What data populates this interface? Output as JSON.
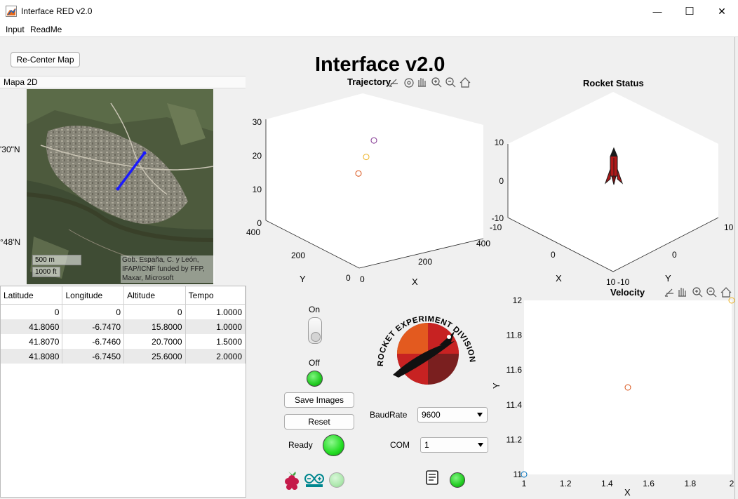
{
  "window": {
    "title": "Interface RED v2.0",
    "controls": {
      "minimize": "—",
      "maximize": "☐",
      "close": "✕"
    }
  },
  "menu": {
    "items": [
      "Input",
      "ReadMe"
    ]
  },
  "map_panel": {
    "recenter_label": "Re-Center Map",
    "tab_label": "Mapa 2D",
    "lat_tick_1": "'30\"N",
    "lat_tick_2": "°48'N",
    "scale_m": "500 m",
    "scale_ft": "1000 ft",
    "attribution_1": "Gob. España, C. y León,",
    "attribution_2": "IFAP/ICNF funded by FFP,",
    "attribution_3": "Maxar, Microsoft",
    "route_color": "#1a1aff"
  },
  "table": {
    "headers": [
      "Latitude",
      "Longitude",
      "Altitude",
      "Tempo"
    ],
    "rows": [
      [
        "0",
        "0",
        "0",
        "1.0000"
      ],
      [
        "41.8060",
        "-6.7470",
        "15.8000",
        "1.0000"
      ],
      [
        "41.8070",
        "-6.7460",
        "20.7000",
        "1.5000"
      ],
      [
        "41.8080",
        "-6.7450",
        "25.6000",
        "2.0000"
      ]
    ]
  },
  "header": {
    "title": "Interface v2.0"
  },
  "trajectory": {
    "title": "Trajectory",
    "z_ticks": [
      "30",
      "20",
      "10",
      "0"
    ],
    "y_ticks": [
      "400",
      "200",
      "0"
    ],
    "x_ticks": [
      "0",
      "200",
      "400"
    ],
    "xlabel": "X",
    "ylabel": "Y"
  },
  "rocket_status": {
    "title": "Rocket Status",
    "z_ticks": [
      "10",
      "0",
      "-10"
    ],
    "x_ticks": [
      "-10",
      "0",
      "10"
    ],
    "y_ticks": [
      "-10",
      "0",
      "10"
    ],
    "xlabel": "X",
    "ylabel": "Y",
    "rocket_color": "#b01818"
  },
  "controls": {
    "on_label": "On",
    "off_label": "Off",
    "save_images": "Save Images",
    "reset": "Reset",
    "ready_label": "Ready",
    "baudrate_label": "BaudRate",
    "baudrate_value": "9600",
    "com_label": "COM",
    "com_value": "1",
    "lamp_on_color": "#22dd22",
    "lamp_dim_color": "#aee8ae"
  },
  "logo": {
    "text": "ROCKET EXPERIMENT DIVISION",
    "colors": {
      "dark": "#7a1f1f",
      "mid": "#c72222",
      "orange": "#e35a1f"
    }
  },
  "chart_data": [
    {
      "type": "scatter",
      "title": "Trajectory",
      "dimensions": 3,
      "xlabel": "X",
      "ylabel": "Y",
      "zlabel": "",
      "xlim": [
        0,
        400
      ],
      "ylim": [
        0,
        400
      ],
      "zlim": [
        0,
        30
      ],
      "series": [
        {
          "x": [
            0,
            0,
            0
          ],
          "y": [
            0,
            0,
            0
          ],
          "z": [
            15.8,
            20.7,
            25.6
          ],
          "colors": [
            "#d95319",
            "#edb120",
            "#7e2f8e"
          ]
        }
      ]
    },
    {
      "type": "scatter",
      "title": "Velocity",
      "xlabel": "X",
      "ylabel": "Y",
      "xlim": [
        1,
        2
      ],
      "ylim": [
        11,
        12
      ],
      "x_ticks": [
        "1",
        "1.2",
        "1.4",
        "1.6",
        "1.8",
        "2"
      ],
      "y_ticks": [
        "12",
        "11.8",
        "11.6",
        "11.4",
        "11.2",
        "11"
      ],
      "series": [
        {
          "x": [
            1,
            1.5,
            2
          ],
          "y": [
            11,
            11.5,
            12
          ],
          "colors": [
            "#0072bd",
            "#d95319",
            "#edb120"
          ]
        }
      ]
    }
  ]
}
